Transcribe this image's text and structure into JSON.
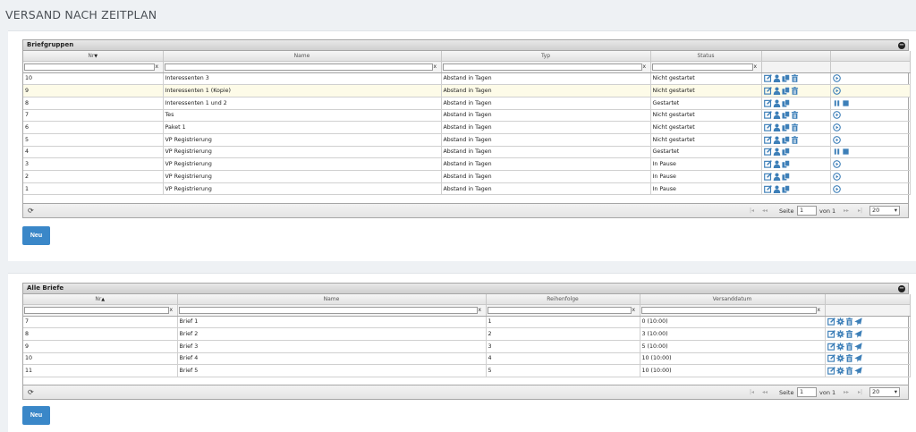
{
  "page": {
    "title": "VERSAND NACH ZEITPLAN"
  },
  "briefgruppen": {
    "title": "Briefgruppen",
    "columns": [
      "Nr",
      "Name",
      "Typ",
      "Status"
    ],
    "rows": [
      {
        "nr": "10",
        "name": "Interessenten 3",
        "typ": "Abstand in Tagen",
        "status": "Nicht gestartet",
        "delete": true,
        "state": "play"
      },
      {
        "nr": "9",
        "name": "Interessenten 1 (Kopie)",
        "typ": "Abstand in Tagen",
        "status": "Nicht gestartet",
        "delete": true,
        "state": "play",
        "highlight": true
      },
      {
        "nr": "8",
        "name": "Interessenten 1 und 2",
        "typ": "Abstand in Tagen",
        "status": "Gestartet",
        "delete": false,
        "state": "pause-stop"
      },
      {
        "nr": "7",
        "name": "Tes",
        "typ": "Abstand in Tagen",
        "status": "Nicht gestartet",
        "delete": true,
        "state": "play"
      },
      {
        "nr": "6",
        "name": "Paket 1",
        "typ": "Abstand in Tagen",
        "status": "Nicht gestartet",
        "delete": true,
        "state": "play"
      },
      {
        "nr": "5",
        "name": "VP Registrierung",
        "typ": "Abstand in Tagen",
        "status": "Nicht gestartet",
        "delete": true,
        "state": "play"
      },
      {
        "nr": "4",
        "name": "VP Registrierung",
        "typ": "Abstand in Tagen",
        "status": "Gestartet",
        "delete": false,
        "state": "pause-stop"
      },
      {
        "nr": "3",
        "name": "VP Registrierung",
        "typ": "Abstand in Tagen",
        "status": "In Pause",
        "delete": false,
        "state": "play"
      },
      {
        "nr": "2",
        "name": "VP Registrierung",
        "typ": "Abstand in Tagen",
        "status": "In Pause",
        "delete": false,
        "state": "play"
      },
      {
        "nr": "1",
        "name": "VP Registrierung",
        "typ": "Abstand in Tagen",
        "status": "In Pause",
        "delete": false,
        "state": "play"
      }
    ],
    "pager": {
      "page_label": "Seite",
      "page_value": "1",
      "of_label": "von 1",
      "page_size": "20"
    },
    "new_button": "Neu"
  },
  "briefe": {
    "title": "Alle Briefe",
    "columns": [
      "Nr",
      "Name",
      "Reihenfolge",
      "Versanddatum"
    ],
    "rows": [
      {
        "nr": "7",
        "name": "Brief 1",
        "reihenfolge": "1",
        "versanddatum": "0 (10:00)"
      },
      {
        "nr": "8",
        "name": "Brief 2",
        "reihenfolge": "2",
        "versanddatum": "3 (10:00)"
      },
      {
        "nr": "9",
        "name": "Brief 3",
        "reihenfolge": "3",
        "versanddatum": "5 (10:00)"
      },
      {
        "nr": "10",
        "name": "Brief 4",
        "reihenfolge": "4",
        "versanddatum": "10 (10:00)"
      },
      {
        "nr": "11",
        "name": "Brief 5",
        "reihenfolge": "5",
        "versanddatum": "10 (10:00)"
      }
    ],
    "pager": {
      "page_label": "Seite",
      "page_value": "1",
      "of_label": "von 1",
      "page_size": "20"
    },
    "new_button": "Neu"
  },
  "colors": {
    "accent": "#3a87c8",
    "icon": "#3d7fb8",
    "highlight_row": "#fdfbe8"
  },
  "icons": [
    "edit-icon",
    "user-icon",
    "copy-icon",
    "trash-icon",
    "play-icon",
    "pause-icon",
    "stop-icon",
    "gear-icon",
    "send-icon",
    "refresh-icon",
    "collapse-icon"
  ]
}
